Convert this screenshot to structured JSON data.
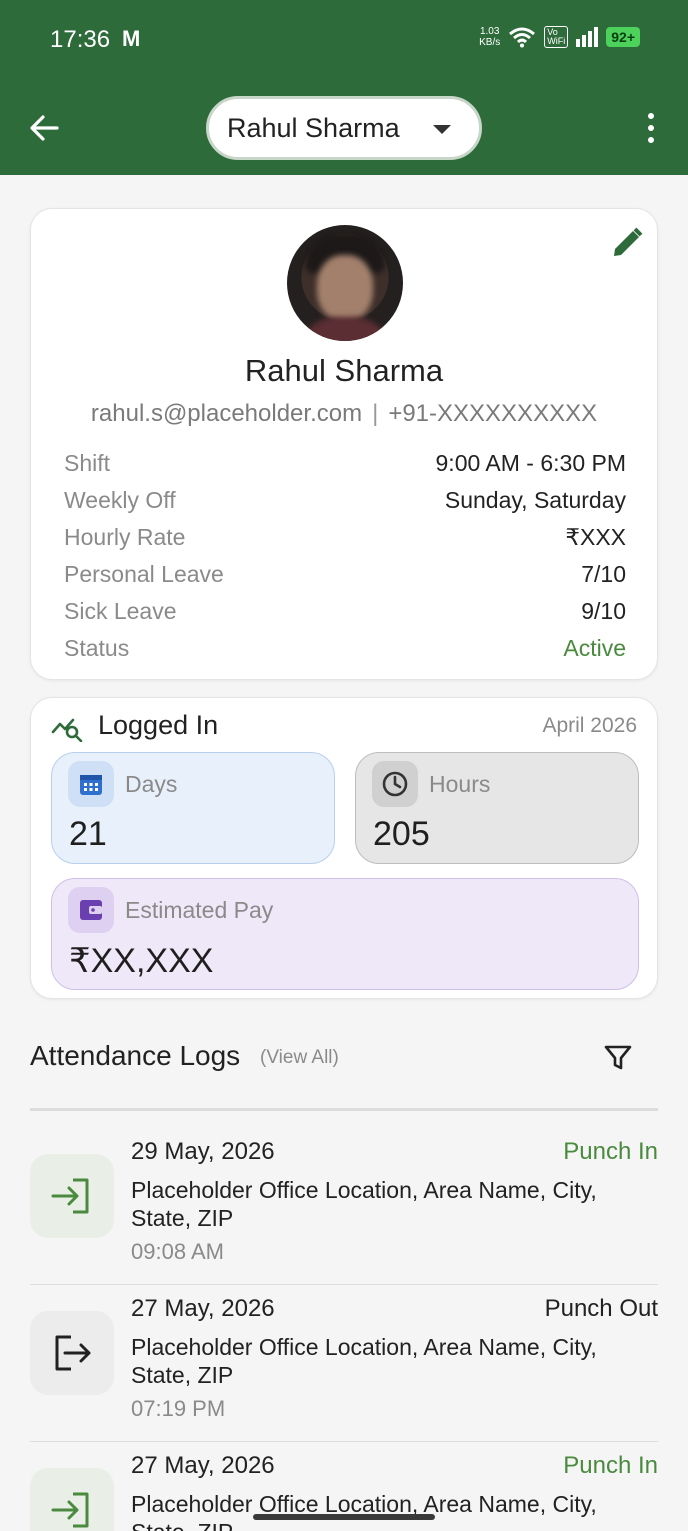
{
  "status_bar": {
    "time": "17:36",
    "mail_icon": "M",
    "net_speed_value": "1.03",
    "net_speed_unit": "KB/s",
    "volte_line1": "Vo",
    "volte_line2": "WiFi",
    "battery": "92+"
  },
  "app_bar": {
    "selected_employee": "Rahul Sharma",
    "colors": {
      "primary": "#2e6b3a"
    }
  },
  "profile": {
    "name": "Rahul Sharma",
    "email": "rahul.s@placeholder.com",
    "separator": "|",
    "phone": "+91-XXXXXXXXXX",
    "rows": [
      {
        "label": "Shift",
        "value": "9:00 AM - 6:30 PM"
      },
      {
        "label": "Weekly Off",
        "value": "Sunday, Saturday"
      },
      {
        "label": "Hourly Rate",
        "value": "₹XXX"
      },
      {
        "label": "Personal Leave",
        "value": "7/10"
      },
      {
        "label": "Sick Leave",
        "value": "9/10"
      },
      {
        "label": "Status",
        "value": "Active"
      }
    ]
  },
  "logged_in": {
    "title": "Logged In",
    "month": "April 2026",
    "days": {
      "label": "Days",
      "value": "21"
    },
    "hours": {
      "label": "Hours",
      "value": "205"
    },
    "pay": {
      "label": "Estimated Pay",
      "value": "₹XX,XXX"
    }
  },
  "attendance": {
    "title": "Attendance Logs",
    "view_all": "(View All)",
    "logs": [
      {
        "date": "29 May, 2026",
        "type": "Punch In",
        "location": "Placeholder Office Location, Area Name, City, State, ZIP",
        "time": "09:08 AM"
      },
      {
        "date": "27 May, 2026",
        "type": "Punch Out",
        "location": "Placeholder Office Location, Area Name, City, State, ZIP",
        "time": "07:19 PM"
      },
      {
        "date": "27 May, 2026",
        "type": "Punch In",
        "location": "Placeholder Office Location, Area Name, City, State, ZIP",
        "time": ""
      }
    ]
  }
}
